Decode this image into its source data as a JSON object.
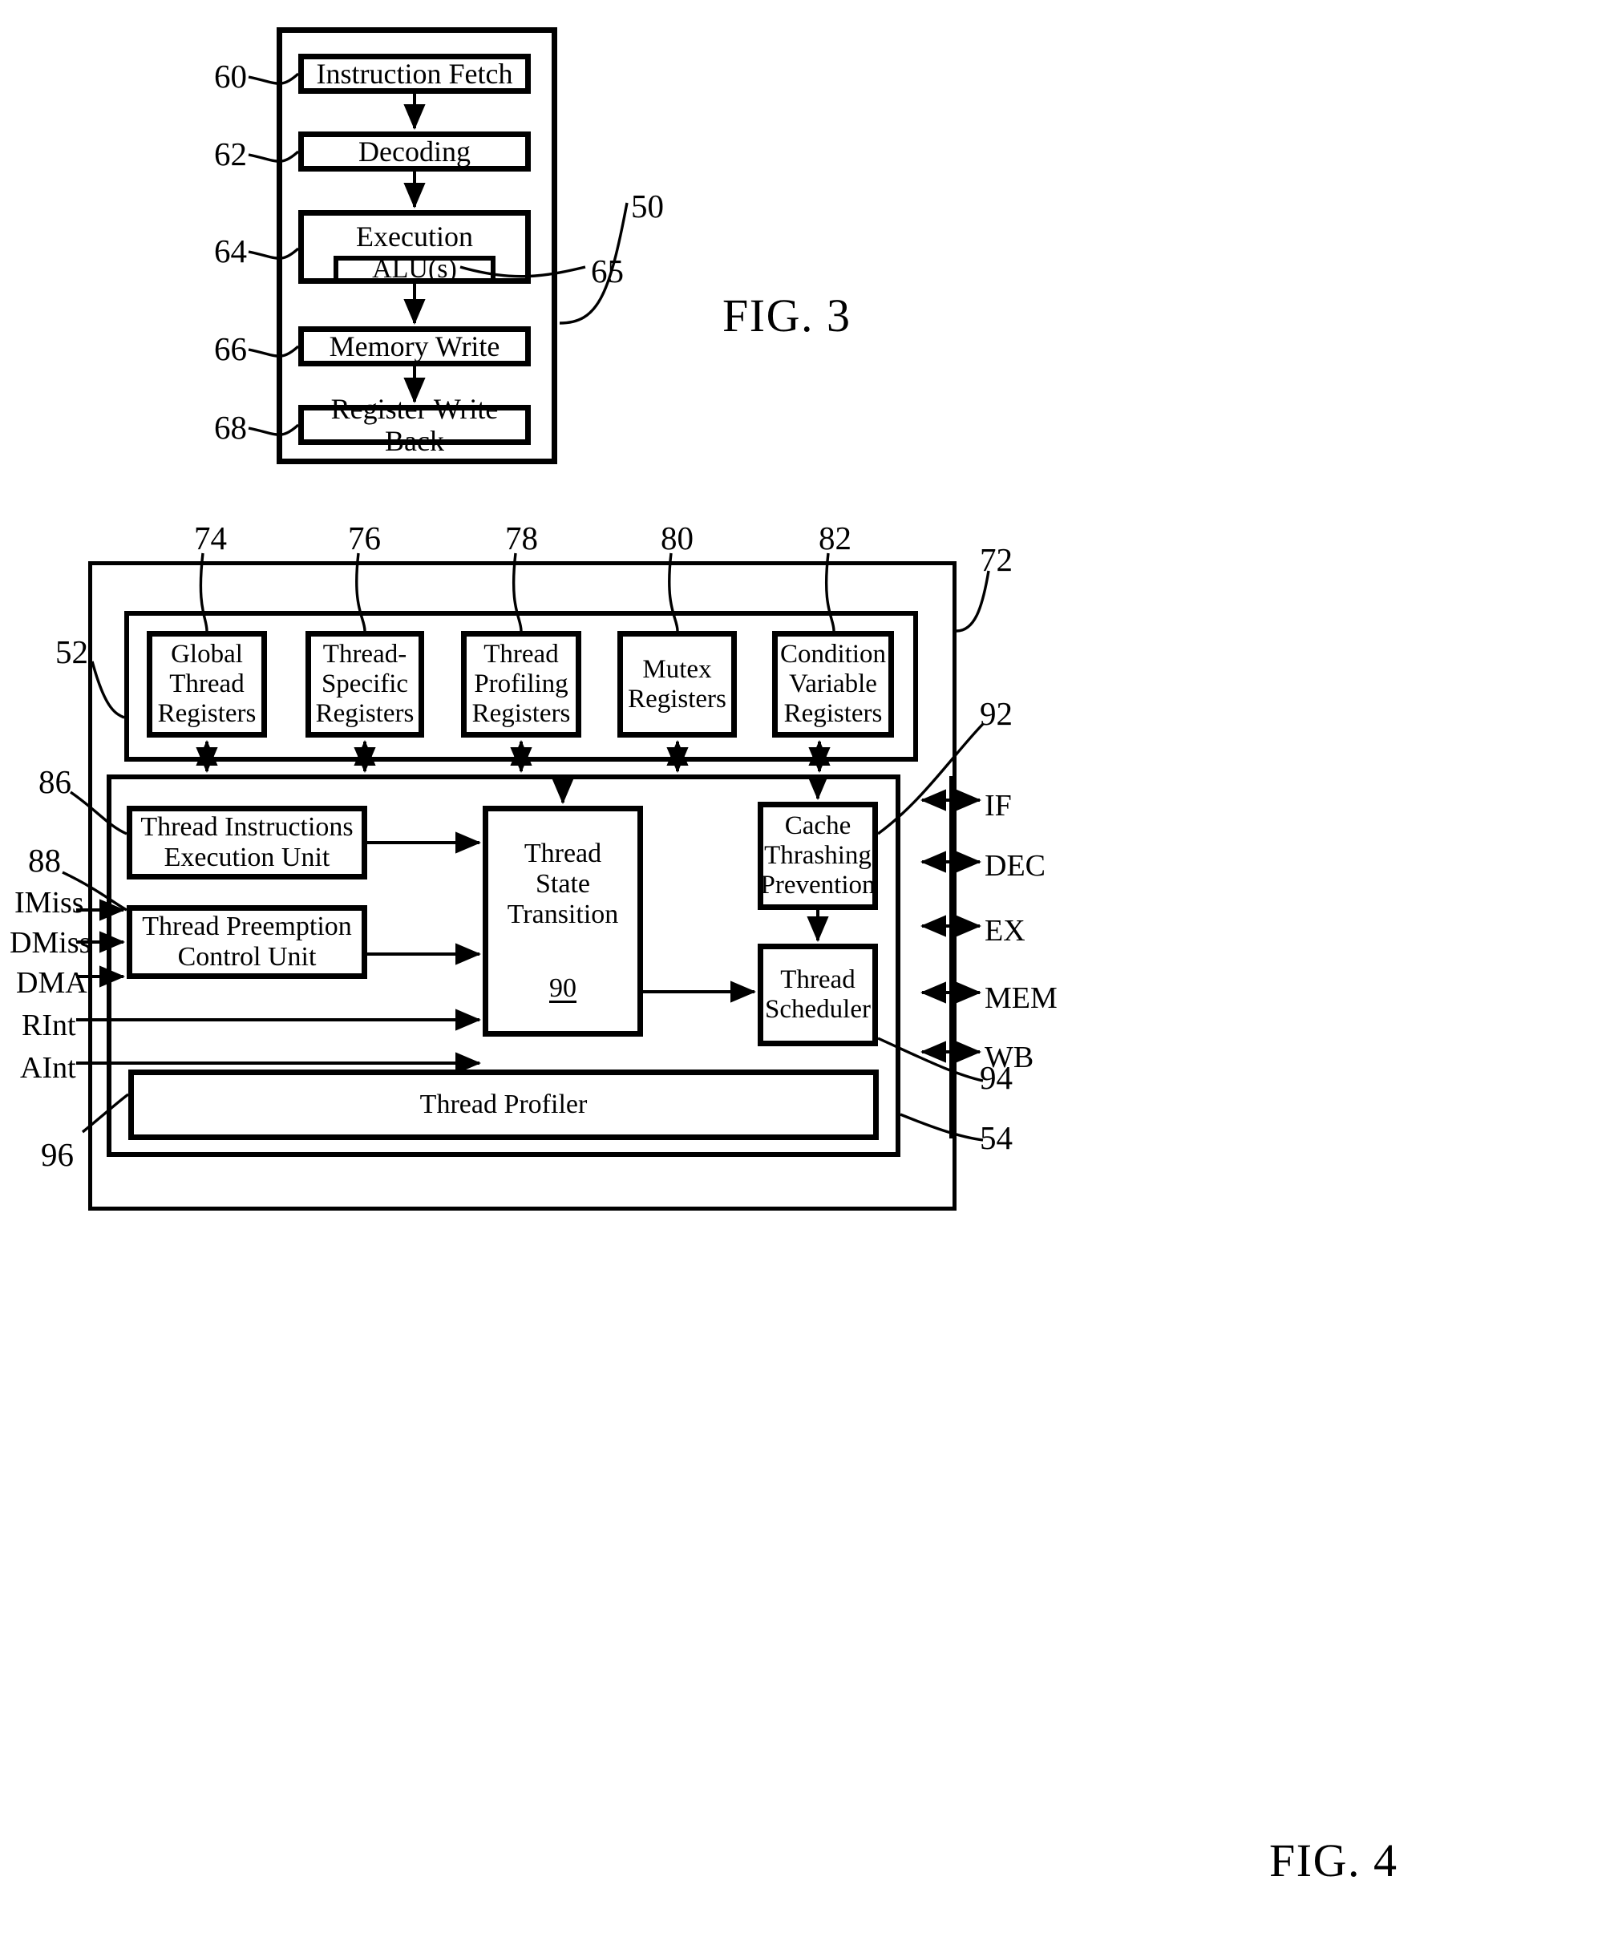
{
  "figure3": {
    "title": "FIG. 3",
    "outer_ref": "50",
    "stages": [
      {
        "ref": "60",
        "label": "Instruction Fetch"
      },
      {
        "ref": "62",
        "label": "Decoding"
      },
      {
        "ref": "64",
        "label": "Execution"
      },
      {
        "ref": "66",
        "label": "Memory Write"
      },
      {
        "ref": "68",
        "label": "Register Write Back"
      }
    ],
    "alu": {
      "ref": "65",
      "label": "ALU(s)"
    }
  },
  "figure4": {
    "title": "FIG. 4",
    "refs": {
      "outer_container": "72",
      "register_bank": "52",
      "core_unit": "54",
      "thread_instructions_execution_unit": "86",
      "thread_preemption_control_unit": "88",
      "thread_state_transition": "90",
      "cache_thrashing_prevention": "92",
      "thread_scheduler": "94",
      "thread_profiler": "96"
    },
    "register_boxes": [
      {
        "ref": "74",
        "lines": [
          "Global",
          "Thread",
          "Registers"
        ]
      },
      {
        "ref": "76",
        "lines": [
          "Thread-",
          "Specific",
          "Registers"
        ]
      },
      {
        "ref": "78",
        "lines": [
          "Thread",
          "Profiling",
          "Registers"
        ]
      },
      {
        "ref": "80",
        "lines": [
          "Mutex",
          "Registers"
        ]
      },
      {
        "ref": "82",
        "lines": [
          "Condition",
          "Variable",
          "Registers"
        ]
      }
    ],
    "units": {
      "thread_instructions_execution_unit": [
        "Thread Instructions",
        "Execution Unit"
      ],
      "thread_preemption_control_unit": [
        "Thread Preemption",
        "Control Unit"
      ],
      "thread_state_transition": [
        "Thread",
        "State",
        "Transition"
      ],
      "thread_state_transition_ref": "90",
      "cache_thrashing_prevention": [
        "Cache",
        "Thrashing",
        "Prevention"
      ],
      "thread_scheduler": [
        "Thread",
        "Scheduler"
      ],
      "thread_profiler": "Thread Profiler"
    },
    "left_signals": [
      "IMiss",
      "DMiss",
      "DMA",
      "RInt",
      "AInt"
    ],
    "right_signals": [
      "IF",
      "DEC",
      "EX",
      "MEM",
      "WB"
    ]
  }
}
